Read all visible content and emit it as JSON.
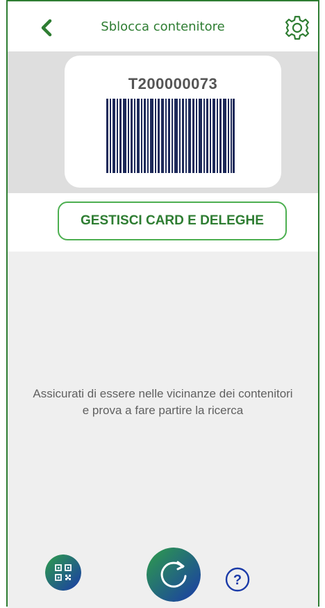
{
  "header": {
    "title": "Sblocca contenitore",
    "back_icon": "chevron-left-icon",
    "settings_icon": "gear-icon"
  },
  "card": {
    "number": "T200000073",
    "barcode_icon": "barcode-icon"
  },
  "actions": {
    "manage_label": "GESTISCI CARD E DELEGHE"
  },
  "main": {
    "hint_line1": "Assicurati di essere nelle vicinanze dei contenitori",
    "hint_line2": "e prova a fare partire la ricerca"
  },
  "bottom": {
    "qr_icon": "qr-code-icon",
    "refresh_icon": "refresh-icon",
    "help_icon": "help-icon"
  },
  "colors": {
    "brand_green": "#2e7d32",
    "button_border": "#4caf50",
    "gradient_start": "#2e9d4a",
    "gradient_end": "#1a3aa8",
    "card_background": "#dedede",
    "main_background": "#efefef"
  }
}
